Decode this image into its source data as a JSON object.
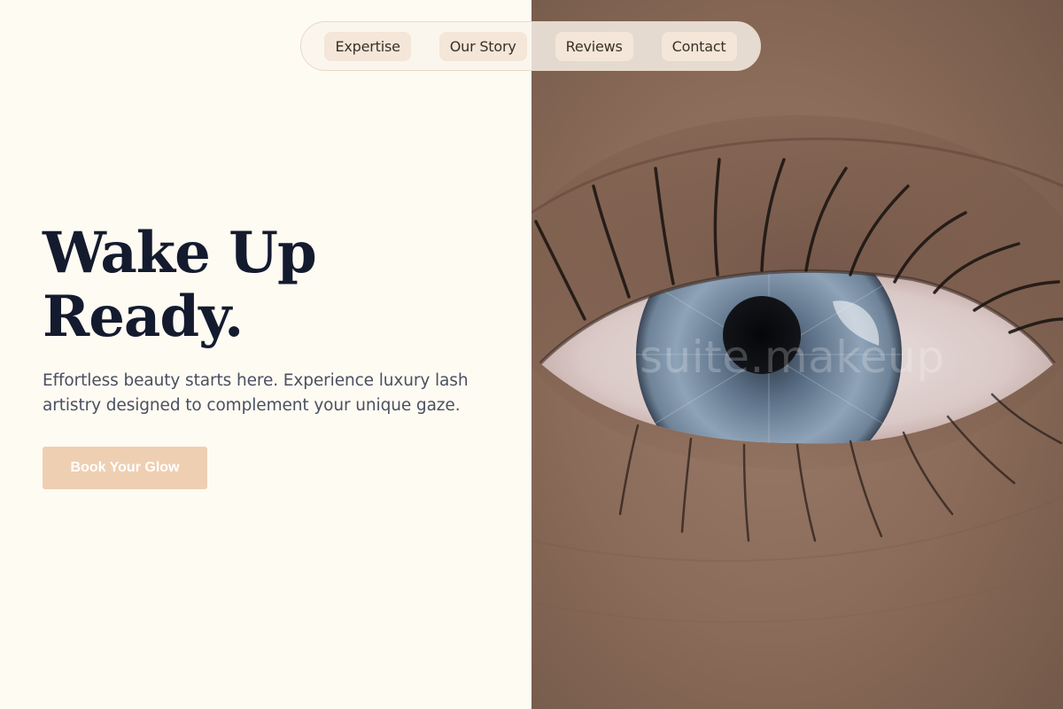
{
  "nav": {
    "items": [
      {
        "label": "Expertise"
      },
      {
        "label": "Our Story"
      },
      {
        "label": "Reviews"
      },
      {
        "label": "Contact"
      }
    ]
  },
  "hero": {
    "title_line1": "Wake Up",
    "title_line2": "Ready.",
    "subtitle": "Effortless beauty starts here. Experience luxury lash artistry designed to complement your unique gaze.",
    "cta_label": "Book Your Glow"
  },
  "image": {
    "watermark": "suite.makeup",
    "subject": "close-up of a blue eye with long lashes"
  },
  "colors": {
    "background": "#fefbf3",
    "headline": "#141b2e",
    "body_text": "#4a5060",
    "cta_background": "#efcfb2",
    "nav_pill": "#f4e6d8",
    "iris": "#7f93a8"
  }
}
